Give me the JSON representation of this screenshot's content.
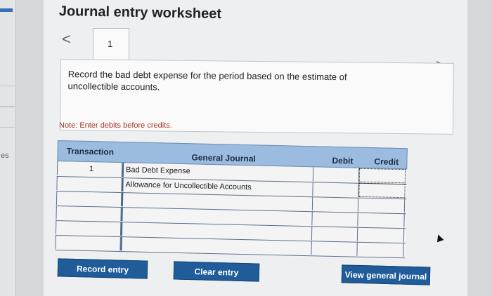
{
  "page": {
    "title": "Journal entry worksheet",
    "nav_prev": "<",
    "nav_next": ">",
    "tab_label": "1"
  },
  "sidebar": {
    "partial_text": "es"
  },
  "description": "Record the bad debt expense for the period based on the estimate of uncollectible accounts.",
  "note": "Note: Enter debits before credits.",
  "journal": {
    "headers": {
      "transaction": "Transaction",
      "general_journal": "General Journal",
      "debit": "Debit",
      "credit": "Credit"
    },
    "rows": [
      {
        "transaction": "1",
        "account": "Bad Debt Expense",
        "debit": "",
        "credit": ""
      },
      {
        "transaction": "",
        "account": "Allowance for Uncollectible Accounts",
        "debit": "",
        "credit": ""
      },
      {
        "transaction": "",
        "account": "",
        "debit": "",
        "credit": ""
      },
      {
        "transaction": "",
        "account": "",
        "debit": "",
        "credit": ""
      },
      {
        "transaction": "",
        "account": "",
        "debit": "",
        "credit": ""
      },
      {
        "transaction": "",
        "account": "",
        "debit": "",
        "credit": ""
      }
    ]
  },
  "buttons": {
    "record_entry": "Record entry",
    "clear_entry": "Clear entry",
    "view_general_journal": "View general journal"
  },
  "colors": {
    "header_bg": "#9bbce0",
    "button_bg": "#1f5c99",
    "note_color": "#a23a2c"
  }
}
